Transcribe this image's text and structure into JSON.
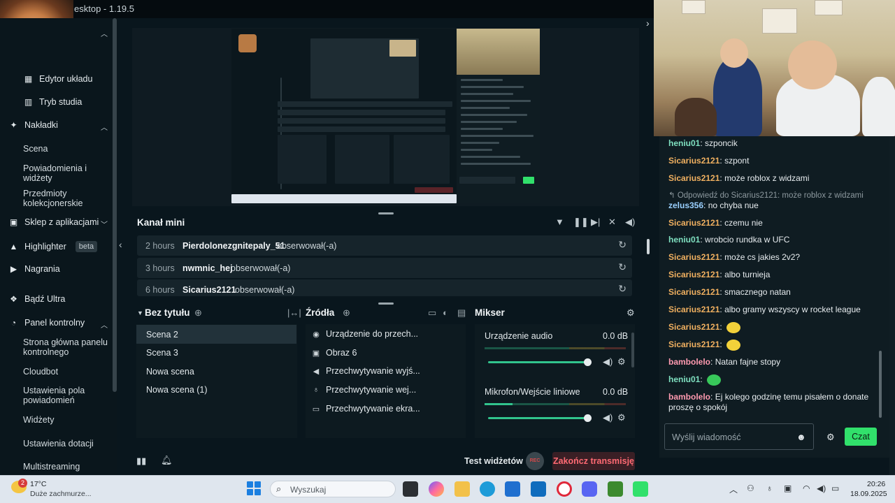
{
  "window": {
    "title": "esktop - 1.19.5"
  },
  "sidebar": {
    "items": [
      {
        "label": "Edytor układu"
      },
      {
        "label": "Tryb studia"
      },
      {
        "label": "Nakładki"
      },
      {
        "label": "Scena"
      },
      {
        "label": "Powiadomienia i widżety"
      },
      {
        "label": "Przedmioty kolekcjonerskie"
      },
      {
        "label": "Sklep z aplikacjami"
      },
      {
        "label": "Highlighter",
        "badge": "beta"
      },
      {
        "label": "Nagrania"
      },
      {
        "label": "Bądź Ultra"
      },
      {
        "label": "Panel kontrolny"
      },
      {
        "label": "Strona główna panelu kontrolnego"
      },
      {
        "label": "Cloudbot"
      },
      {
        "label": "Ustawienia pola powiadomień"
      },
      {
        "label": "Widżety"
      },
      {
        "label": "Ustawienia dotacji"
      },
      {
        "label": "Multistreaming"
      }
    ]
  },
  "mini_feed": {
    "title": "Kanał mini",
    "events": [
      {
        "time": "2 hours",
        "user": "Pierdolonezgnitepaly_51",
        "action": "obserwował(-a)"
      },
      {
        "time": "3 hours",
        "user": "nwmnic_hej",
        "action": "obserwował(-a)"
      },
      {
        "time": "6 hours",
        "user": "Sicarius2121",
        "action": "obserwował(-a)"
      }
    ]
  },
  "scenes": {
    "title": "Bez tytułu",
    "items": [
      "Scena 2",
      "Scena 3",
      "Nowa scena",
      "Nowa scena (1)"
    ],
    "selected": "Scena 2"
  },
  "sources": {
    "title": "Źródła",
    "items": [
      {
        "label": "Urządzenie do przech...",
        "icon": "camera-icon"
      },
      {
        "label": "Obraz 6",
        "icon": "image-icon"
      },
      {
        "label": "Przechwytywanie wyjś...",
        "icon": "speaker-icon"
      },
      {
        "label": "Przechwytywanie wej...",
        "icon": "microphone-icon"
      },
      {
        "label": "Przechwytywanie ekra...",
        "icon": "monitor-icon"
      }
    ]
  },
  "mixer": {
    "title": "Mikser",
    "channels": [
      {
        "name": "Urządzenie audio",
        "db": "0.0 dB",
        "volume": 1.0
      },
      {
        "name": "Mikrofon/Wejście liniowe",
        "db": "0.0 dB",
        "volume": 1.0,
        "level": 0.2
      }
    ]
  },
  "footer": {
    "test_widgets": "Test widżetów",
    "rec": "REC",
    "end_stream": "Zakończ transmisję"
  },
  "chat": {
    "messages": [
      {
        "user": "heniu01",
        "color": "#7fe0c0",
        "text": "szponcik"
      },
      {
        "user": "Sicarius2121",
        "color": "#f0b060",
        "text": "szpont"
      },
      {
        "user": "Sicarius2121",
        "color": "#f0b060",
        "text": "może roblox z widzami"
      },
      {
        "reply_to": "Odpowiedź do Sicarius2121: może roblox z widzami",
        "user": "zelus356",
        "color": "#9ad0ff",
        "text": "no chyba nue"
      },
      {
        "user": "Sicarius2121",
        "color": "#f0b060",
        "text": "czemu nie"
      },
      {
        "user": "heniu01",
        "color": "#7fe0c0",
        "text": "wrobcio rundka w UFC"
      },
      {
        "user": "Sicarius2121",
        "color": "#f0b060",
        "text": "może cs jakies 2v2?"
      },
      {
        "user": "Sicarius2121",
        "color": "#f0b060",
        "text": "albo turnieja"
      },
      {
        "user": "Sicarius2121",
        "color": "#f0b060",
        "text": "smacznego natan"
      },
      {
        "user": "Sicarius2121",
        "color": "#f0b060",
        "text": "albo gramy wszyscy w rocket league"
      },
      {
        "user": "Sicarius2121",
        "color": "#f0b060",
        "text": "",
        "emote": "yellow-emote"
      },
      {
        "user": "Sicarius2121",
        "color": "#f0b060",
        "text": "",
        "emote": "yellow-emote"
      },
      {
        "user": "bambolelo",
        "color": "#ff9ab0",
        "text": "Natan fajne stopy"
      },
      {
        "user": "heniu01",
        "color": "#7fe0c0",
        "text": "",
        "emote": "green-emote"
      },
      {
        "user": "bambolelo",
        "color": "#ff9ab0",
        "text": "Ej kolego godzinę temu pisałem o donate proszę o spokój"
      }
    ],
    "input_placeholder": "Wyślij wiadomość",
    "send_label": "Czat",
    "send_color": "#31e06b"
  },
  "taskbar": {
    "weather_temp": "17°C",
    "weather_desc": "Duże zachmurze...",
    "weather_badge": "2",
    "search_placeholder": "Wyszukaj",
    "time": "20:26",
    "date": "18.09.2025"
  }
}
